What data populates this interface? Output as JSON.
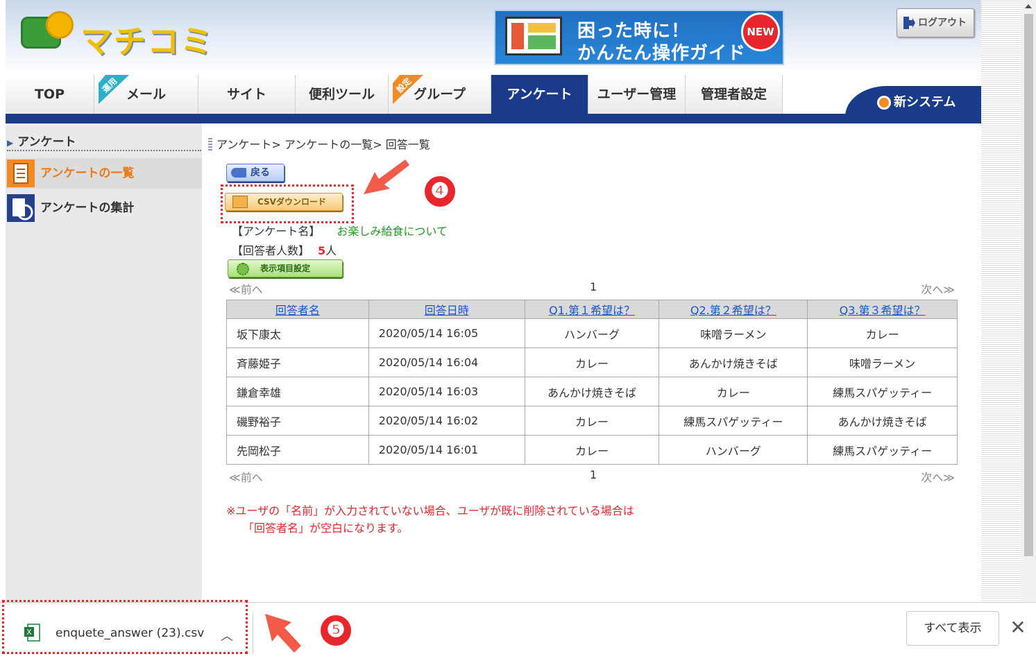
{
  "header": {
    "logo_text": "マチコミ",
    "banner_line1": "困った時に！",
    "banner_line2": "かんたん操作ガイド",
    "banner_badge": "NEW",
    "logout_label": "ログアウト"
  },
  "nav": {
    "tabs": [
      {
        "label": "TOP",
        "corner": ""
      },
      {
        "label": "メール",
        "corner": "運用"
      },
      {
        "label": "サイト",
        "corner": ""
      },
      {
        "label": "便利ツール",
        "corner": ""
      },
      {
        "label": "グループ",
        "corner": "設定"
      },
      {
        "label": "アンケート",
        "corner": ""
      },
      {
        "label": "ユーザー管理",
        "corner": ""
      },
      {
        "label": "管理者設定",
        "corner": ""
      }
    ],
    "active_tab": "アンケート",
    "new_system": "新システム"
  },
  "sidebar": {
    "heading": "アンケート",
    "items": [
      {
        "label": "アンケートの一覧",
        "active": true
      },
      {
        "label": "アンケートの集計",
        "active": false
      }
    ]
  },
  "main": {
    "breadcrumb": "アンケート> アンケートの一覧> 回答一覧",
    "back_label": "戻る",
    "csv_label": "CSVダウンロード",
    "survey_name_label": "【アンケート名】",
    "survey_name": "お楽しみ給食について",
    "respondents_label": "【回答者人数】",
    "respondents_count": "5",
    "respondents_unit": "人",
    "display_settings_label": "表示項目設定",
    "pager": {
      "prev": "前へ",
      "page": "1",
      "next": "次へ"
    },
    "columns": [
      "回答者名",
      "回答日時",
      "Q1.第１希望は？",
      "Q2.第２希望は？",
      "Q3.第３希望は？"
    ],
    "rows": [
      [
        "坂下康太",
        "2020/05/14 16:05",
        "ハンバーグ",
        "味噌ラーメン",
        "カレー"
      ],
      [
        "斉藤姫子",
        "2020/05/14 16:04",
        "カレー",
        "あんかけ焼きそば",
        "味噌ラーメン"
      ],
      [
        "鎌倉幸雄",
        "2020/05/14 16:03",
        "あんかけ焼きそば",
        "カレー",
        "練馬スパゲッティー"
      ],
      [
        "磯野裕子",
        "2020/05/14 16:02",
        "カレー",
        "練馬スパゲッティー",
        "あんかけ焼きそば"
      ],
      [
        "先岡松子",
        "2020/05/14 16:01",
        "カレー",
        "ハンバーグ",
        "練馬スパゲッティー"
      ]
    ],
    "note_line1": "※ユーザの「名前」が入力されていない場合、ユーザが既に削除されている場合は",
    "note_line2": "「回答者名」が空白になります。"
  },
  "annotations": {
    "step4": "❹",
    "step5": "❺",
    "color": "#e8262d"
  },
  "download_bar": {
    "file_name": "enquete_answer (23).csv",
    "show_all": "すべて表示",
    "close": "✕"
  },
  "icons": [
    "logout-icon",
    "gear-icon",
    "list-icon",
    "chart-icon",
    "back-icon",
    "box-icon",
    "settings-icon",
    "excel-icon",
    "chevron-up-icon",
    "close-icon"
  ]
}
